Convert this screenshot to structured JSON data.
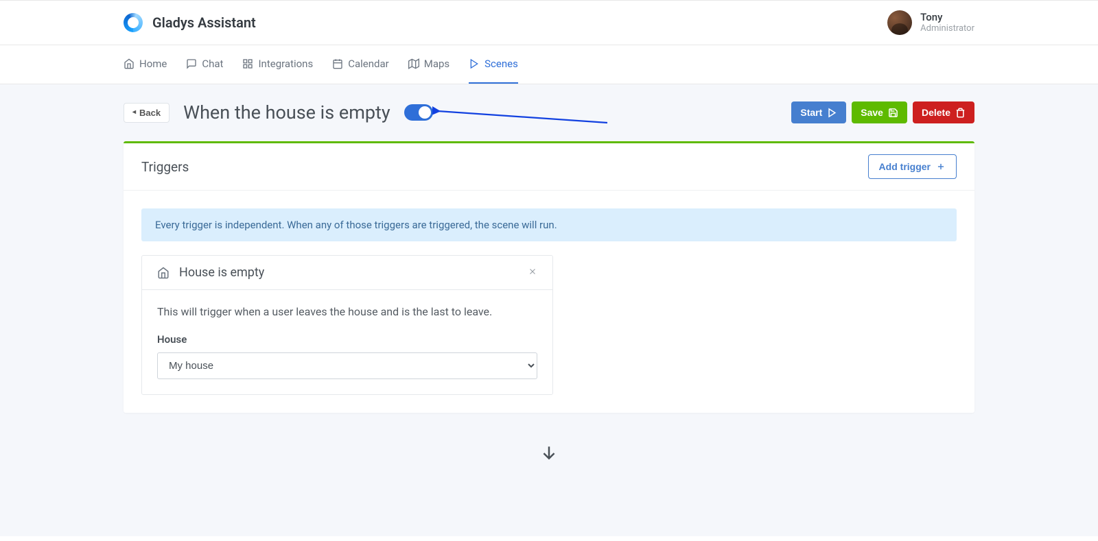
{
  "brand": {
    "name": "Gladys Assistant"
  },
  "user": {
    "name": "Tony",
    "role": "Administrator"
  },
  "nav": {
    "home": "Home",
    "chat": "Chat",
    "integrations": "Integrations",
    "calendar": "Calendar",
    "maps": "Maps",
    "scenes": "Scenes"
  },
  "scene": {
    "back_label": "Back",
    "title": "When the house is empty",
    "toggle_on": true,
    "start_label": "Start",
    "save_label": "Save",
    "delete_label": "Delete"
  },
  "triggers_section": {
    "title": "Triggers",
    "add_button": "Add trigger",
    "info": "Every trigger is independent. When any of those triggers are triggered, the scene will run."
  },
  "trigger": {
    "title": "House is empty",
    "description": "This will trigger when a user leaves the house and is the last to leave.",
    "house_label": "House",
    "house_value": "My house"
  }
}
